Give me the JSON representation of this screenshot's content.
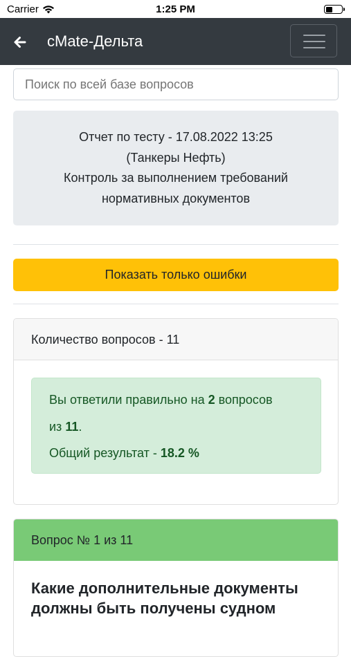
{
  "status_bar": {
    "carrier": "Carrier",
    "time": "1:25 PM",
    "icons": [
      "wifi-icon",
      "battery-icon"
    ]
  },
  "nav": {
    "title": "cMate-Дельта",
    "icons": [
      "back-arrow-icon",
      "hamburger-menu-icon"
    ]
  },
  "search": {
    "placeholder": "Поиск по всей базе вопросов"
  },
  "report": {
    "line1": "Отчет по тесту - 17.08.2022 13:25",
    "line2": "(Танкеры Нефть)",
    "line3": "Контроль за выполнением требований",
    "line4": "нормативных документов"
  },
  "errors_button": {
    "label": "Показать только ошибки",
    "color": "#ffc107"
  },
  "summary": {
    "header": "Количество вопросов - 11",
    "answered_prefix": "Вы ответили правильно на ",
    "correct": "2",
    "answered_suffix": " вопросов",
    "of_prefix": "из ",
    "total": "11",
    "of_suffix": ".",
    "result_prefix": "Общий результат - ",
    "result": "18.2 %"
  },
  "question": {
    "header": "Вопрос № 1 из 11",
    "text": "Какие дополнительные документы должны быть получены судном",
    "header_color": "#79ca76"
  }
}
